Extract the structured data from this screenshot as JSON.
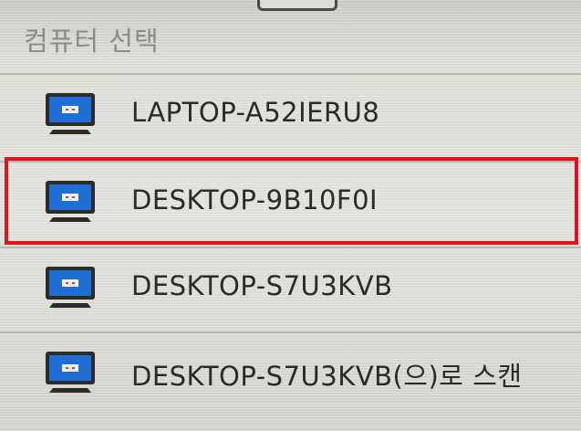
{
  "header": {
    "title": "컴퓨터 선택"
  },
  "computers": [
    {
      "name": "LAPTOP-A52IERU8",
      "icon": "computer-icon"
    },
    {
      "name": "DESKTOP-9B10F0I",
      "icon": "computer-icon",
      "highlighted": true
    },
    {
      "name": "DESKTOP-S7U3KVB",
      "icon": "computer-icon"
    },
    {
      "name": "DESKTOP-S7U3KVB(으)로 스캔",
      "icon": "computer-icon"
    }
  ],
  "colors": {
    "highlight_border": "#e3121a",
    "icon_blue": "#1f6ed4",
    "icon_frame": "#2b2b2b"
  }
}
